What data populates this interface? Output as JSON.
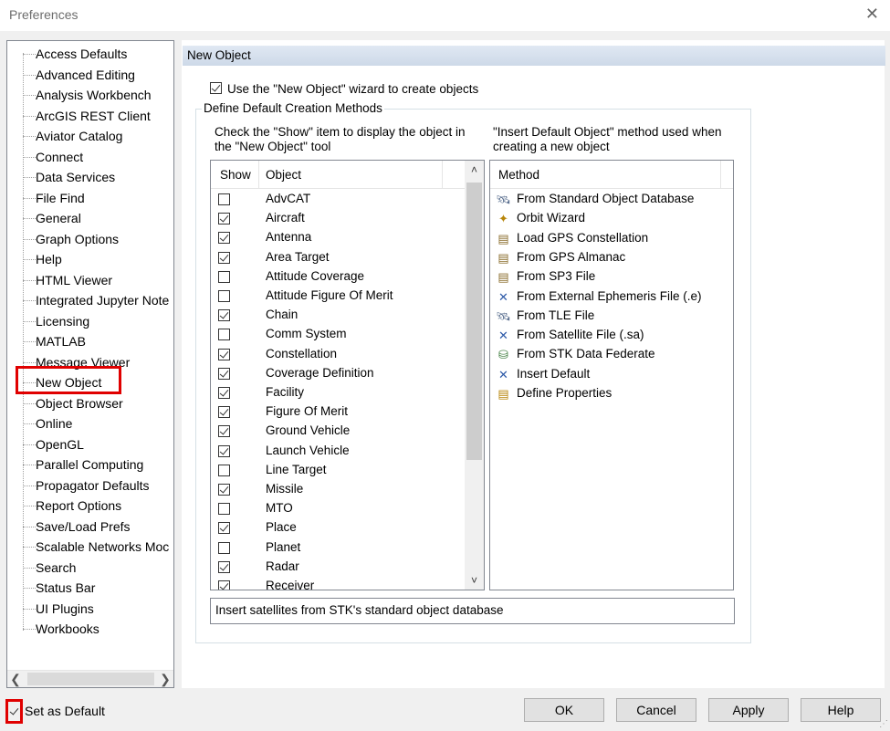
{
  "window": {
    "title": "Preferences",
    "close_glyph": "✕"
  },
  "tree": {
    "items": [
      "Access Defaults",
      "Advanced Editing",
      "Analysis Workbench",
      "ArcGIS REST Client",
      "Aviator Catalog",
      "Connect",
      "Data Services",
      "File Find",
      "General",
      "Graph Options",
      "Help",
      "HTML Viewer",
      "Integrated Jupyter Note",
      "Licensing",
      "MATLAB",
      "Message Viewer",
      "New Object",
      "Object Browser",
      "Online",
      "OpenGL",
      "Parallel Computing",
      "Propagator Defaults",
      "Report Options",
      "Save/Load Prefs",
      "Scalable Networks Moc",
      "Search",
      "Status Bar",
      "UI Plugins",
      "Workbooks"
    ],
    "selected": "New Object",
    "scroll_left": "❮",
    "scroll_right": "❯"
  },
  "panel": {
    "header": "New Object",
    "wizard_checkbox": {
      "label": "Use the \"New Object\" wizard to create objects",
      "checked": true
    },
    "group_title": "Define Default Creation Methods",
    "show_instructions": "Check the \"Show\" item to display the object in the \"New Object\" tool",
    "method_instructions": "\"Insert Default Object\" method used when creating a new object",
    "object_list": {
      "headers": {
        "show": "Show",
        "object": "Object"
      },
      "rows": [
        {
          "name": "AdvCAT",
          "checked": false
        },
        {
          "name": "Aircraft",
          "checked": true
        },
        {
          "name": "Antenna",
          "checked": true
        },
        {
          "name": "Area Target",
          "checked": true
        },
        {
          "name": "Attitude Coverage",
          "checked": false
        },
        {
          "name": "Attitude Figure Of Merit",
          "checked": false
        },
        {
          "name": "Chain",
          "checked": true
        },
        {
          "name": "Comm System",
          "checked": false
        },
        {
          "name": "Constellation",
          "checked": true
        },
        {
          "name": "Coverage Definition",
          "checked": true
        },
        {
          "name": "Facility",
          "checked": true
        },
        {
          "name": "Figure Of Merit",
          "checked": true
        },
        {
          "name": "Ground Vehicle",
          "checked": true
        },
        {
          "name": "Launch Vehicle",
          "checked": true
        },
        {
          "name": "Line Target",
          "checked": false
        },
        {
          "name": "Missile",
          "checked": true
        },
        {
          "name": "MTO",
          "checked": false
        },
        {
          "name": "Place",
          "checked": true
        },
        {
          "name": "Planet",
          "checked": false
        },
        {
          "name": "Radar",
          "checked": true
        },
        {
          "name": "Receiver",
          "checked": true
        }
      ],
      "scroll_up": "˄",
      "scroll_down": "˅"
    },
    "method_list": {
      "header": "Method",
      "rows": [
        {
          "label": "From Standard Object Database",
          "icon": "database-satellite-icon",
          "glyph": "🛰"
        },
        {
          "label": "Orbit Wizard",
          "icon": "orbit-wizard-icon",
          "glyph": "✦"
        },
        {
          "label": "Load GPS Constellation",
          "icon": "gps-file-icon",
          "glyph": "▤"
        },
        {
          "label": "From GPS Almanac",
          "icon": "gps-almanac-icon",
          "glyph": "▤"
        },
        {
          "label": "From SP3 File",
          "icon": "sp3-file-icon",
          "glyph": "▤"
        },
        {
          "label": "From External Ephemeris File (.e)",
          "icon": "ephemeris-file-icon",
          "glyph": "✕"
        },
        {
          "label": "From TLE File",
          "icon": "tle-file-icon",
          "glyph": "🛰"
        },
        {
          "label": "From Satellite File (.sa)",
          "icon": "satellite-file-icon",
          "glyph": "✕"
        },
        {
          "label": "From STK Data Federate",
          "icon": "data-federate-icon",
          "glyph": "⛁"
        },
        {
          "label": "Insert Default",
          "icon": "insert-default-icon",
          "glyph": "✕"
        },
        {
          "label": "Define Properties",
          "icon": "define-properties-icon",
          "glyph": "▤"
        }
      ]
    },
    "description": "Insert satellites from STK's standard object database"
  },
  "footer": {
    "set_default": {
      "label": "Set as Default",
      "checked": true
    },
    "buttons": {
      "ok": "OK",
      "cancel": "Cancel",
      "apply": "Apply",
      "help": "Help"
    },
    "grip_glyph": "⋰"
  },
  "colors": {
    "highlight": "#e00000",
    "panel_header": "#cdd9e8",
    "selected_item": "#e00000"
  }
}
